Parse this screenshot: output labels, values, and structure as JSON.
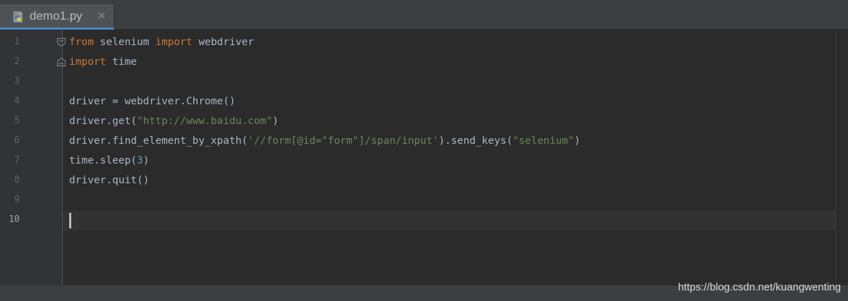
{
  "tab": {
    "filename": "demo1.py",
    "icon": "python-file-icon",
    "close_icon": "close-icon"
  },
  "editor": {
    "current_line": 10,
    "lines": [
      {
        "number": "1",
        "tokens": [
          {
            "t": "from",
            "c": "kw"
          },
          {
            "t": " selenium ",
            "c": ""
          },
          {
            "t": "import",
            "c": "kw"
          },
          {
            "t": " webdriver",
            "c": ""
          }
        ]
      },
      {
        "number": "2",
        "tokens": [
          {
            "t": "import",
            "c": "kw"
          },
          {
            "t": " time",
            "c": ""
          }
        ]
      },
      {
        "number": "3",
        "tokens": []
      },
      {
        "number": "4",
        "tokens": [
          {
            "t": "driver = webdriver.Chrome()",
            "c": ""
          }
        ]
      },
      {
        "number": "5",
        "tokens": [
          {
            "t": "driver.get(",
            "c": ""
          },
          {
            "t": "\"http://www.baidu.com\"",
            "c": "str"
          },
          {
            "t": ")",
            "c": ""
          }
        ]
      },
      {
        "number": "6",
        "tokens": [
          {
            "t": "driver.find_element_by_xpath(",
            "c": ""
          },
          {
            "t": "'//form[@id=\"form\"]/span/input'",
            "c": "str"
          },
          {
            "t": ").send_keys(",
            "c": ""
          },
          {
            "t": "\"selenium\"",
            "c": "str"
          },
          {
            "t": ")",
            "c": ""
          }
        ]
      },
      {
        "number": "7",
        "tokens": [
          {
            "t": "time.sleep(",
            "c": ""
          },
          {
            "t": "3",
            "c": "num"
          },
          {
            "t": ")",
            "c": ""
          }
        ]
      },
      {
        "number": "8",
        "tokens": [
          {
            "t": "driver.quit()",
            "c": ""
          }
        ]
      },
      {
        "number": "9",
        "tokens": []
      },
      {
        "number": "10",
        "tokens": []
      }
    ]
  },
  "colors": {
    "background": "#2b2b2b",
    "keyword": "#cc7832",
    "string": "#6a8759",
    "number": "#6897bb",
    "default_text": "#a9b7c6",
    "tab_underline": "#4a88c7"
  },
  "watermark": {
    "text": "https://blog.csdn.net/kuangwenting"
  }
}
